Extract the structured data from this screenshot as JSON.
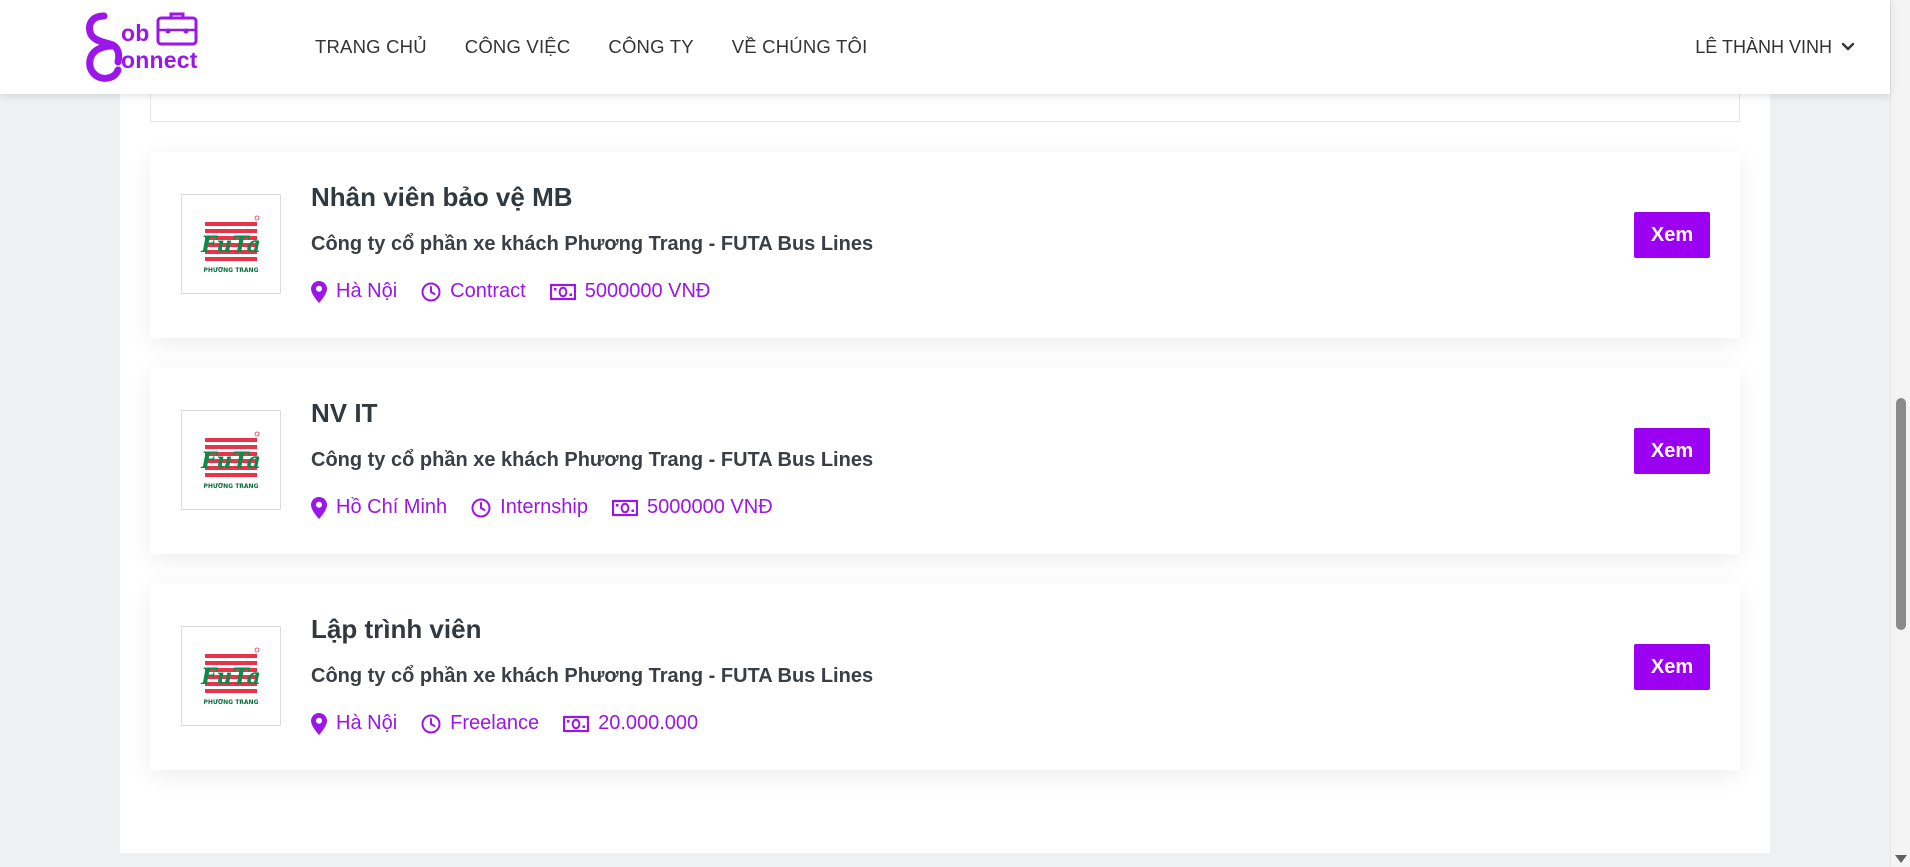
{
  "brand": {
    "logo_text_1": "ob",
    "logo_text_2": "onnect",
    "accent_color": "#9b16e8",
    "button_color": "#9b00f0"
  },
  "nav": {
    "items": [
      {
        "label": "TRANG CHỦ"
      },
      {
        "label": "CÔNG VIỆC"
      },
      {
        "label": "CÔNG TY"
      },
      {
        "label": "VỀ CHÚNG TÔI"
      }
    ]
  },
  "user": {
    "name": "LÊ THÀNH VINH",
    "icon": "chevron-down-icon"
  },
  "jobs": [
    {
      "title": "Nhân viên bảo vệ MB",
      "company": "Công ty cổ phần xe khách Phương Trang - FUTA Bus Lines",
      "location": "Hà Nội",
      "type": "Contract",
      "salary": "5000000 VNĐ",
      "button": "Xem"
    },
    {
      "title": "NV IT",
      "company": "Công ty cổ phần xe khách Phương Trang - FUTA Bus Lines",
      "location": "Hồ Chí Minh",
      "type": "Internship",
      "salary": "5000000 VNĐ",
      "button": "Xem"
    },
    {
      "title": "Lập trình viên",
      "company": "Công ty cổ phần xe khách Phương Trang - FUTA Bus Lines",
      "location": "Hà Nội",
      "type": "Freelance",
      "salary": "20.000.000",
      "button": "Xem"
    }
  ],
  "company_logo": {
    "text": "FuTa",
    "subtext": "PHƯƠNG TRANG"
  },
  "icons": {
    "location": "map-pin-icon",
    "type": "clock-icon",
    "salary": "money-bill-icon"
  }
}
